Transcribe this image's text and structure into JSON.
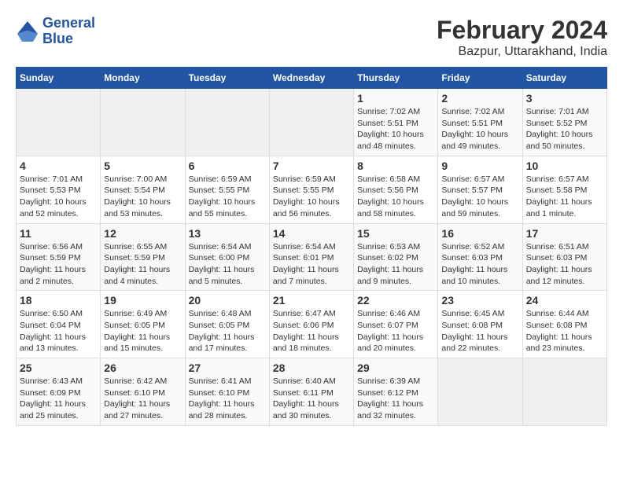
{
  "header": {
    "logo_line1": "General",
    "logo_line2": "Blue",
    "title": "February 2024",
    "subtitle": "Bazpur, Uttarakhand, India"
  },
  "days_of_week": [
    "Sunday",
    "Monday",
    "Tuesday",
    "Wednesday",
    "Thursday",
    "Friday",
    "Saturday"
  ],
  "weeks": [
    [
      {
        "num": "",
        "info": ""
      },
      {
        "num": "",
        "info": ""
      },
      {
        "num": "",
        "info": ""
      },
      {
        "num": "",
        "info": ""
      },
      {
        "num": "1",
        "info": "Sunrise: 7:02 AM\nSunset: 5:51 PM\nDaylight: 10 hours\nand 48 minutes."
      },
      {
        "num": "2",
        "info": "Sunrise: 7:02 AM\nSunset: 5:51 PM\nDaylight: 10 hours\nand 49 minutes."
      },
      {
        "num": "3",
        "info": "Sunrise: 7:01 AM\nSunset: 5:52 PM\nDaylight: 10 hours\nand 50 minutes."
      }
    ],
    [
      {
        "num": "4",
        "info": "Sunrise: 7:01 AM\nSunset: 5:53 PM\nDaylight: 10 hours\nand 52 minutes."
      },
      {
        "num": "5",
        "info": "Sunrise: 7:00 AM\nSunset: 5:54 PM\nDaylight: 10 hours\nand 53 minutes."
      },
      {
        "num": "6",
        "info": "Sunrise: 6:59 AM\nSunset: 5:55 PM\nDaylight: 10 hours\nand 55 minutes."
      },
      {
        "num": "7",
        "info": "Sunrise: 6:59 AM\nSunset: 5:55 PM\nDaylight: 10 hours\nand 56 minutes."
      },
      {
        "num": "8",
        "info": "Sunrise: 6:58 AM\nSunset: 5:56 PM\nDaylight: 10 hours\nand 58 minutes."
      },
      {
        "num": "9",
        "info": "Sunrise: 6:57 AM\nSunset: 5:57 PM\nDaylight: 10 hours\nand 59 minutes."
      },
      {
        "num": "10",
        "info": "Sunrise: 6:57 AM\nSunset: 5:58 PM\nDaylight: 11 hours\nand 1 minute."
      }
    ],
    [
      {
        "num": "11",
        "info": "Sunrise: 6:56 AM\nSunset: 5:59 PM\nDaylight: 11 hours\nand 2 minutes."
      },
      {
        "num": "12",
        "info": "Sunrise: 6:55 AM\nSunset: 5:59 PM\nDaylight: 11 hours\nand 4 minutes."
      },
      {
        "num": "13",
        "info": "Sunrise: 6:54 AM\nSunset: 6:00 PM\nDaylight: 11 hours\nand 5 minutes."
      },
      {
        "num": "14",
        "info": "Sunrise: 6:54 AM\nSunset: 6:01 PM\nDaylight: 11 hours\nand 7 minutes."
      },
      {
        "num": "15",
        "info": "Sunrise: 6:53 AM\nSunset: 6:02 PM\nDaylight: 11 hours\nand 9 minutes."
      },
      {
        "num": "16",
        "info": "Sunrise: 6:52 AM\nSunset: 6:03 PM\nDaylight: 11 hours\nand 10 minutes."
      },
      {
        "num": "17",
        "info": "Sunrise: 6:51 AM\nSunset: 6:03 PM\nDaylight: 11 hours\nand 12 minutes."
      }
    ],
    [
      {
        "num": "18",
        "info": "Sunrise: 6:50 AM\nSunset: 6:04 PM\nDaylight: 11 hours\nand 13 minutes."
      },
      {
        "num": "19",
        "info": "Sunrise: 6:49 AM\nSunset: 6:05 PM\nDaylight: 11 hours\nand 15 minutes."
      },
      {
        "num": "20",
        "info": "Sunrise: 6:48 AM\nSunset: 6:05 PM\nDaylight: 11 hours\nand 17 minutes."
      },
      {
        "num": "21",
        "info": "Sunrise: 6:47 AM\nSunset: 6:06 PM\nDaylight: 11 hours\nand 18 minutes."
      },
      {
        "num": "22",
        "info": "Sunrise: 6:46 AM\nSunset: 6:07 PM\nDaylight: 11 hours\nand 20 minutes."
      },
      {
        "num": "23",
        "info": "Sunrise: 6:45 AM\nSunset: 6:08 PM\nDaylight: 11 hours\nand 22 minutes."
      },
      {
        "num": "24",
        "info": "Sunrise: 6:44 AM\nSunset: 6:08 PM\nDaylight: 11 hours\nand 23 minutes."
      }
    ],
    [
      {
        "num": "25",
        "info": "Sunrise: 6:43 AM\nSunset: 6:09 PM\nDaylight: 11 hours\nand 25 minutes."
      },
      {
        "num": "26",
        "info": "Sunrise: 6:42 AM\nSunset: 6:10 PM\nDaylight: 11 hours\nand 27 minutes."
      },
      {
        "num": "27",
        "info": "Sunrise: 6:41 AM\nSunset: 6:10 PM\nDaylight: 11 hours\nand 28 minutes."
      },
      {
        "num": "28",
        "info": "Sunrise: 6:40 AM\nSunset: 6:11 PM\nDaylight: 11 hours\nand 30 minutes."
      },
      {
        "num": "29",
        "info": "Sunrise: 6:39 AM\nSunset: 6:12 PM\nDaylight: 11 hours\nand 32 minutes."
      },
      {
        "num": "",
        "info": ""
      },
      {
        "num": "",
        "info": ""
      }
    ]
  ]
}
